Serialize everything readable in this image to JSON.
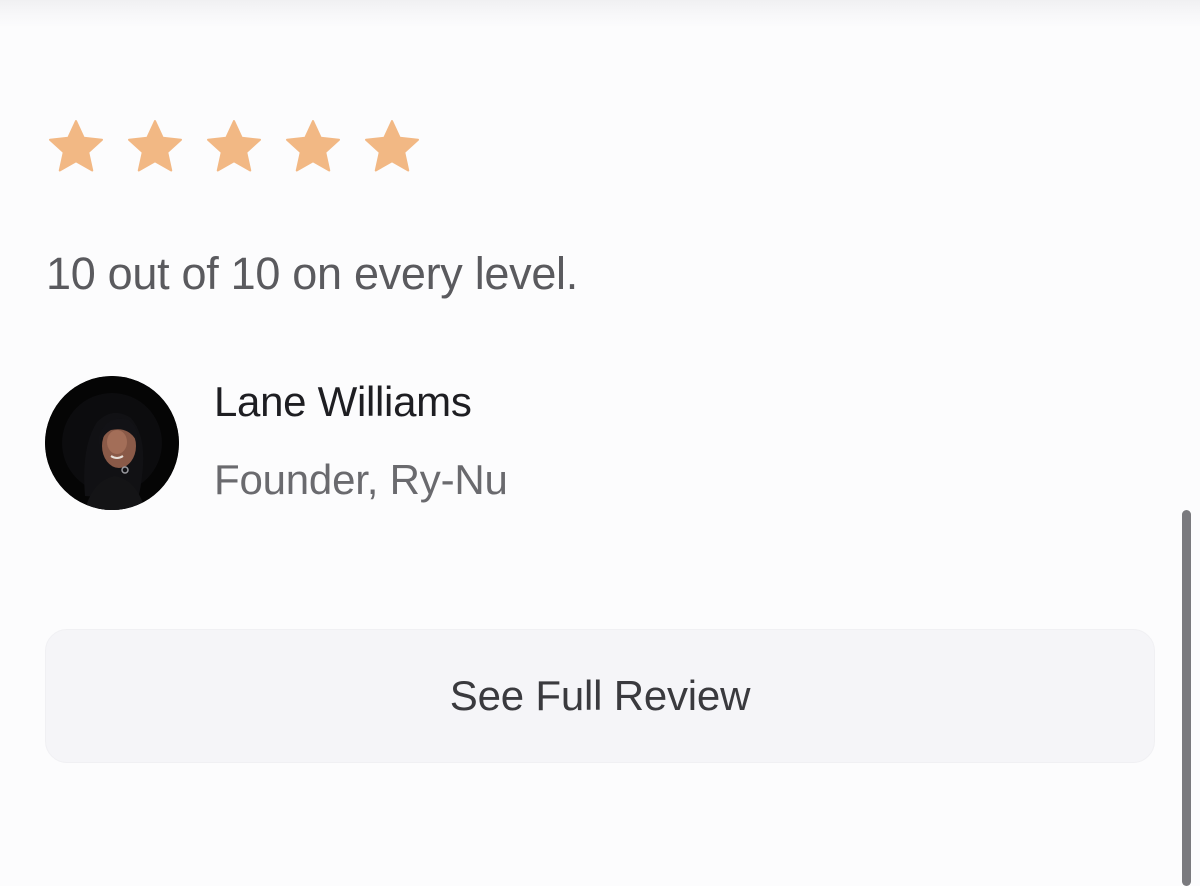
{
  "review": {
    "rating": 5,
    "rating_max": 5,
    "star_color": "#f2b884",
    "quote": "10 out of 10 on every level.",
    "author": {
      "name": "Lane Williams",
      "role": "Founder, Ry-Nu"
    },
    "button_label": "See Full Review"
  },
  "colors": {
    "background": "#fcfcfd",
    "button_background": "#f5f5f8",
    "scrollbar": "#7a7a7e"
  }
}
